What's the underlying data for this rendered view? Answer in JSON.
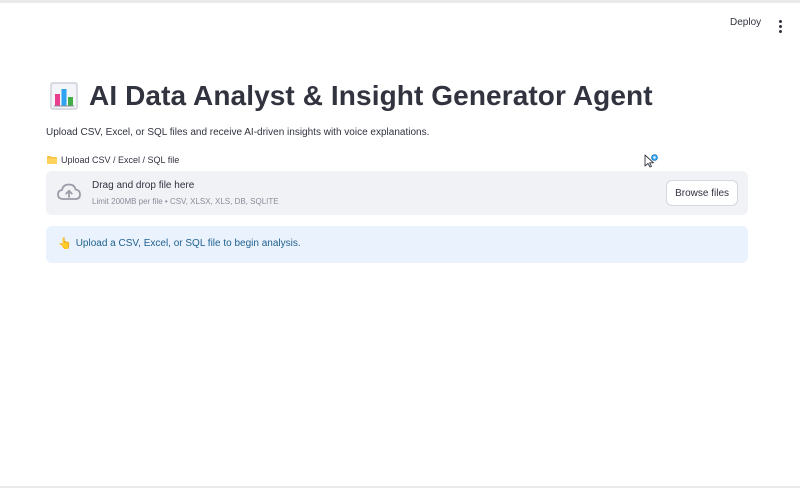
{
  "header": {
    "deploy_label": "Deploy",
    "menu_icon": "more-vertical-icon"
  },
  "main": {
    "title_icon": "bar-chart-icon",
    "title": "AI Data Analyst & Insight Generator Agent",
    "subtitle": "Upload CSV, Excel, or SQL files and receive AI-driven insights with voice explanations."
  },
  "uploader": {
    "label_icon": "folder-icon",
    "label": "Upload CSV / Excel / SQL file",
    "upload_icon": "cloud-upload-icon",
    "drop_title": "Drag and drop file here",
    "drop_limit": "Limit 200MB per file • CSV, XLSX, XLS, DB, SQLITE",
    "browse_label": "Browse files"
  },
  "info": {
    "icon": "pointing-hand-icon",
    "emoji": "👆",
    "message": "Upload a CSV, Excel, or SQL file to begin analysis."
  },
  "colors": {
    "dropzone_bg": "#f0f2f6",
    "info_bg": "#eaf3fd",
    "info_text": "#1f5f8f",
    "text": "#31333f"
  }
}
